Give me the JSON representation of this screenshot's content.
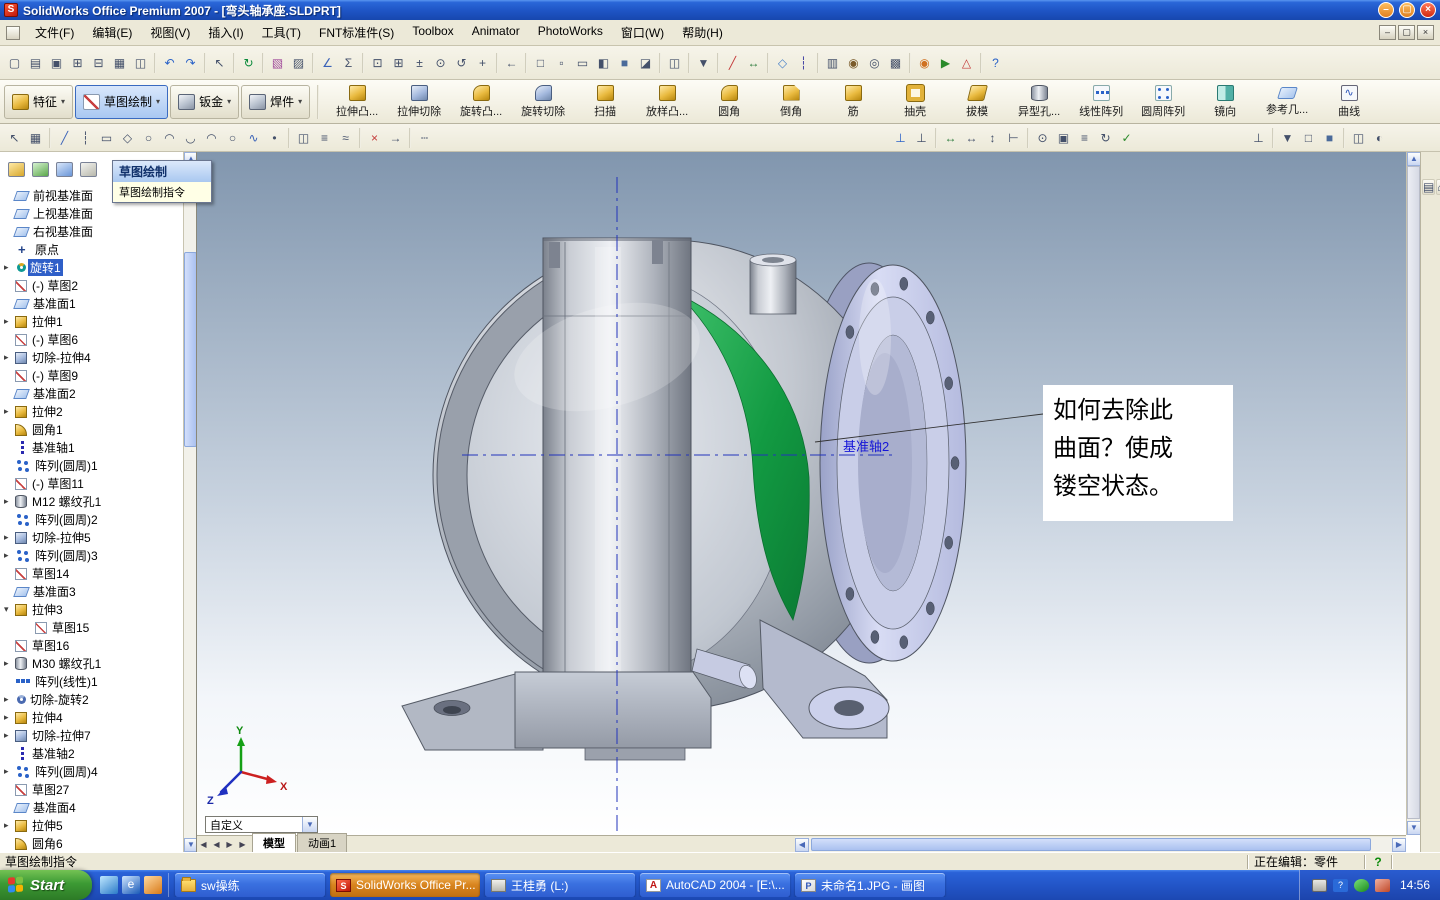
{
  "window": {
    "title": "SolidWorks Office Premium 2007 - [弯头轴承座.SLDPRT]"
  },
  "menu": {
    "items": [
      "文件(F)",
      "编辑(E)",
      "视图(V)",
      "插入(I)",
      "工具(T)",
      "FNT标准件(S)",
      "Toolbox",
      "Animator",
      "PhotoWorks",
      "窗口(W)",
      "帮助(H)"
    ]
  },
  "toolbars": {
    "standard": [
      "new",
      "open",
      "save",
      "make-drawing",
      "make-assembly",
      "print",
      "print-preview",
      "|",
      "undo",
      "redo",
      "|",
      "select",
      "|",
      "rebuild",
      "|",
      "edit-color",
      "texture",
      "|",
      "measure",
      "section-properties",
      "|",
      "zoom-fit",
      "zoom-area",
      "zoom-in-out",
      "zoom-selection",
      "rotate-view",
      "pan",
      "|",
      "previous-view",
      "|",
      "wireframe",
      "hidden-lines-visible",
      "hidden-lines-removed",
      "shaded-with-edges",
      "shaded",
      "shadows",
      "|",
      "section-view",
      "|",
      "view-orientation",
      "|",
      "sketch",
      "smart-dimension",
      "|",
      "reference-plane",
      "reference-axis",
      "|",
      "toolbox-beam",
      "toolbox-bearing",
      "toolbox-cam",
      "toolbox-groove",
      "|",
      "photoworks-render",
      "animator-play",
      "edrawings",
      "|",
      "help"
    ],
    "sketch_left": [
      "select",
      "grid",
      "|",
      "line",
      "centerline",
      "rectangle",
      "polygon",
      "circle",
      "arc",
      "tangent-arc",
      "three-point-arc",
      "ellipse",
      "spline",
      "point",
      "|",
      "mirror-entities",
      "convert-entities",
      "offset-entities",
      "|",
      "trim-entities",
      "extend-entities",
      "|",
      "construction-geometry"
    ],
    "sketch_middle": [
      "add-relation",
      "display-relations",
      "|",
      "smart-dimension",
      "horizontal-dimension",
      "vertical-dimension",
      "ordinate-dimension",
      "|",
      "quick-snaps",
      "sketch-picture",
      "sketch-tools",
      "modify-sketch",
      "close-sketch"
    ],
    "sketch_right": [
      "normal-to",
      "|",
      "standard-views",
      "wireframe",
      "shaded",
      "|",
      "section-view",
      "view-settings"
    ],
    "right_strip": [
      "file-explorer",
      "home",
      "favorites",
      "search",
      "history"
    ]
  },
  "command_manager": {
    "tabs": [
      {
        "label": "特征",
        "icon": "features",
        "active": false
      },
      {
        "label": "草图绘制",
        "icon": "sketch-tab",
        "active": true
      },
      {
        "label": "钣金",
        "icon": "sheet-metal",
        "active": false
      },
      {
        "label": "焊件",
        "icon": "weldments",
        "active": false
      }
    ],
    "tools": [
      {
        "label": "拉伸凸...",
        "icon": "extrude-boss"
      },
      {
        "label": "拉伸切除",
        "icon": "extrude-cut"
      },
      {
        "label": "旋转凸...",
        "icon": "revolve-boss"
      },
      {
        "label": "旋转切除",
        "icon": "revolve-cut"
      },
      {
        "label": "扫描",
        "icon": "sweep"
      },
      {
        "label": "放样凸...",
        "icon": "loft"
      },
      {
        "label": "圆角",
        "icon": "fillet"
      },
      {
        "label": "倒角",
        "icon": "chamfer"
      },
      {
        "label": "筋",
        "icon": "rib"
      },
      {
        "label": "抽壳",
        "icon": "shell"
      },
      {
        "label": "拔模",
        "icon": "draft"
      },
      {
        "label": "异型孔...",
        "icon": "hole-wizard"
      },
      {
        "label": "线性阵列",
        "icon": "linear-pattern"
      },
      {
        "label": "圆周阵列",
        "icon": "circular-pattern"
      },
      {
        "label": "镜向",
        "icon": "mirror"
      },
      {
        "label": "参考几...",
        "icon": "reference-geometry"
      },
      {
        "label": "曲线",
        "icon": "curves"
      }
    ]
  },
  "tooltip": {
    "title": "草图绘制",
    "description": "草图绘制指令"
  },
  "feature_tree": {
    "header_tabs": [
      "featuremanager",
      "propertymanager",
      "configurationmanager",
      "displaymanager"
    ],
    "items": [
      {
        "label": "前视基准面",
        "icon": "plane"
      },
      {
        "label": "上视基准面",
        "icon": "plane"
      },
      {
        "label": "右视基准面",
        "icon": "plane"
      },
      {
        "label": "原点",
        "icon": "origin"
      },
      {
        "label": "旋转1",
        "icon": "revolve",
        "arrow": "right",
        "selected": true
      },
      {
        "label": "(-) 草图2",
        "icon": "sketch"
      },
      {
        "label": "基准面1",
        "icon": "plane"
      },
      {
        "label": "拉伸1",
        "icon": "extrude",
        "arrow": "right"
      },
      {
        "label": "(-) 草图6",
        "icon": "sketch"
      },
      {
        "label": "切除-拉伸4",
        "icon": "cut",
        "arrow": "right"
      },
      {
        "label": "(-) 草图9",
        "icon": "sketch"
      },
      {
        "label": "基准面2",
        "icon": "plane"
      },
      {
        "label": "拉伸2",
        "icon": "extrude",
        "arrow": "right"
      },
      {
        "label": "圆角1",
        "icon": "fillet"
      },
      {
        "label": "基准轴1",
        "icon": "axis"
      },
      {
        "label": "阵列(圆周)1",
        "icon": "cpattern"
      },
      {
        "label": "(-) 草图11",
        "icon": "sketch"
      },
      {
        "label": "M12 螺纹孔1",
        "icon": "hole",
        "arrow": "right"
      },
      {
        "label": "阵列(圆周)2",
        "icon": "cpattern"
      },
      {
        "label": "切除-拉伸5",
        "icon": "cut",
        "arrow": "right"
      },
      {
        "label": "阵列(圆周)3",
        "icon": "cpattern",
        "arrow": "right"
      },
      {
        "label": "草图14",
        "icon": "sketch"
      },
      {
        "label": "基准面3",
        "icon": "plane"
      },
      {
        "label": "拉伸3",
        "icon": "extrude",
        "arrow": "down"
      },
      {
        "label": "草图15",
        "icon": "sketch",
        "indent": 1
      },
      {
        "label": "草图16",
        "icon": "sketch"
      },
      {
        "label": "M30 螺纹孔1",
        "icon": "hole",
        "arrow": "right"
      },
      {
        "label": "阵列(线性)1",
        "icon": "lpattern"
      },
      {
        "label": "切除-旋转2",
        "icon": "cutrev",
        "arrow": "right"
      },
      {
        "label": "拉伸4",
        "icon": "extrude",
        "arrow": "right"
      },
      {
        "label": "切除-拉伸7",
        "icon": "cut",
        "arrow": "right"
      },
      {
        "label": "基准轴2",
        "icon": "axis"
      },
      {
        "label": "阵列(圆周)4",
        "icon": "cpattern",
        "arrow": "right"
      },
      {
        "label": "草图27",
        "icon": "sketch"
      },
      {
        "label": "基准面4",
        "icon": "plane"
      },
      {
        "label": "拉伸5",
        "icon": "extrude",
        "arrow": "right"
      },
      {
        "label": "圆角6",
        "icon": "fillet"
      }
    ]
  },
  "viewport": {
    "axis_label": "基准轴2",
    "annotation_lines": [
      "如何去除此",
      "曲面？使成",
      "镂空状态。"
    ],
    "view_combo": "自定义",
    "doc_tabs": [
      {
        "label": "模型",
        "active": true
      },
      {
        "label": "动画1",
        "active": false
      }
    ],
    "triad": {
      "x": "X",
      "y": "Y",
      "z": "Z"
    }
  },
  "status_bar": {
    "message": "草图绘制指令",
    "editing": "正在编辑：零件",
    "help": "?"
  },
  "taskbar": {
    "start_label": "Start",
    "quick_launch": [
      "show-desktop",
      "internet",
      "media"
    ],
    "tasks": [
      {
        "label": "sw操练",
        "icon": "folder",
        "active": false
      },
      {
        "label": "SolidWorks Office Pr...",
        "icon": "solidworks",
        "active": true
      },
      {
        "label": "王桂勇 (L:)",
        "icon": "drive",
        "active": false
      },
      {
        "label": "AutoCAD 2004 - [E:\\...",
        "icon": "autocad",
        "active": false
      },
      {
        "label": "未命名1.JPG - 画图",
        "icon": "paint",
        "active": false
      }
    ],
    "tray_icons": [
      "keyboard",
      "pen-input",
      "antivirus",
      "volume"
    ],
    "tray_time": "14:56"
  }
}
